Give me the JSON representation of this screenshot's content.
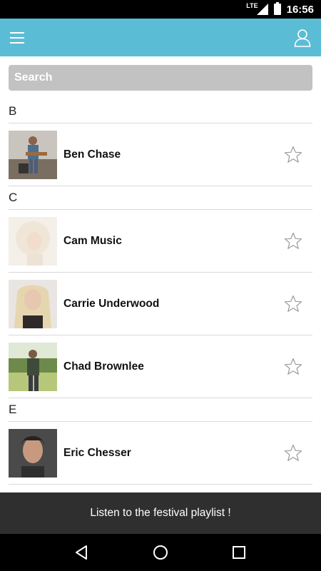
{
  "status_bar": {
    "network": "LTE",
    "time": "16:56"
  },
  "app_bar": {
    "menu_icon": "hamburger-menu-icon",
    "profile_icon": "user-profile-icon",
    "color": "#5bbdd5"
  },
  "search": {
    "placeholder": "Search"
  },
  "sections": [
    {
      "letter": "B",
      "artists": [
        {
          "name": "Ben Chase"
        }
      ]
    },
    {
      "letter": "C",
      "artists": [
        {
          "name": "Cam Music"
        },
        {
          "name": "Carrie Underwood"
        },
        {
          "name": "Chad Brownlee"
        }
      ]
    },
    {
      "letter": "E",
      "artists": [
        {
          "name": "Eric Chesser"
        }
      ]
    }
  ],
  "banner": {
    "text": "Listen to the festival playlist !"
  },
  "nav_bar": {
    "back_icon": "back-triangle-icon",
    "home_icon": "home-circle-icon",
    "recents_icon": "recents-square-icon"
  }
}
